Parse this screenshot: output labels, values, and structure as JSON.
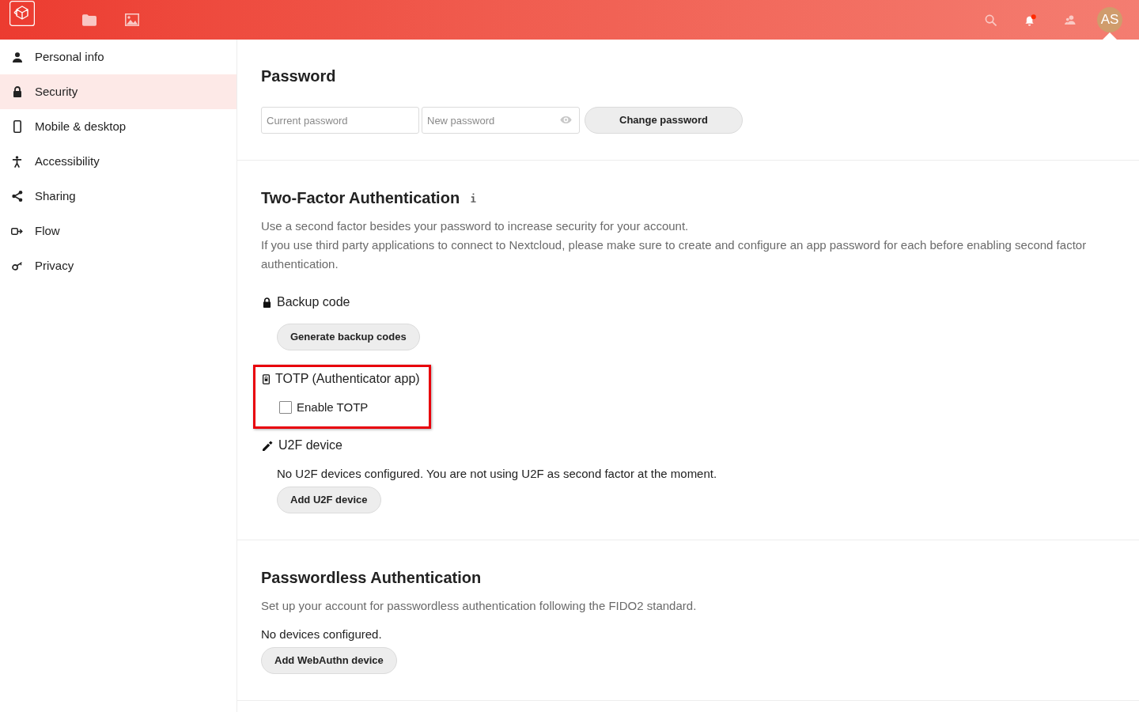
{
  "header": {
    "apps": [
      {
        "selected": false
      },
      {
        "selected": false
      }
    ],
    "notifications": {
      "unread": true
    },
    "avatar": {
      "initials": "AS",
      "selected": true
    }
  },
  "sidebar": {
    "items": [
      {
        "label": "Personal info",
        "selected": false
      },
      {
        "label": "Security",
        "selected": true
      },
      {
        "label": "Mobile & desktop",
        "selected": false
      },
      {
        "label": "Accessibility",
        "selected": false
      },
      {
        "label": "Sharing",
        "selected": false
      },
      {
        "label": "Flow",
        "selected": false
      },
      {
        "label": "Privacy",
        "selected": false
      }
    ]
  },
  "password": {
    "title": "Password",
    "fields": [
      {
        "kind": "plain",
        "placeholder": "Current password"
      },
      {
        "kind": "reveal",
        "placeholder": "New password"
      }
    ],
    "button": "Change password"
  },
  "two_factor": {
    "title": "Two-Factor Authentication",
    "description": [
      "Use a second factor besides your password to increase security for your account.",
      "If you use third party applications to connect to Nextcloud, please make sure to create and configure an app password for each before enabling second factor authentication."
    ],
    "providers": [
      {
        "kind": "action",
        "title": "Backup code",
        "highlighted": false,
        "button": "Generate backup codes"
      },
      {
        "kind": "checkbox",
        "title": "TOTP (Authenticator app)",
        "highlighted": true,
        "checkbox": {
          "label": "Enable TOTP",
          "checked": false
        }
      },
      {
        "kind": "message_action",
        "title": "U2F device",
        "highlighted": false,
        "message": "No U2F devices configured. You are not using U2F as second factor at the moment.",
        "button": "Add U2F device"
      }
    ]
  },
  "passwordless": {
    "title": "Passwordless Authentication",
    "description": "Set up your account for passwordless authentication following the FIDO2 standard.",
    "status": "No devices configured.",
    "button": "Add WebAuthn device"
  }
}
